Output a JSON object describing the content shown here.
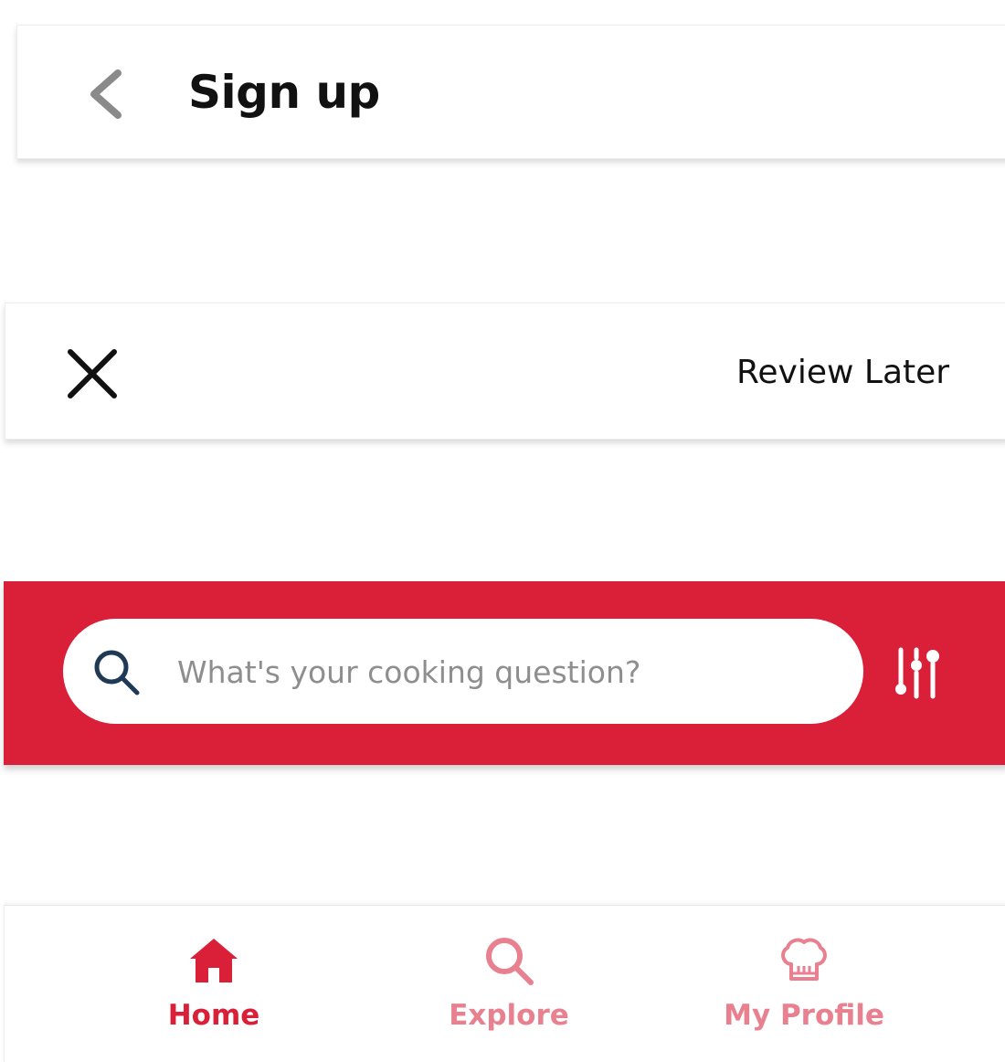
{
  "signup_header": {
    "title": "Sign up",
    "back_icon": "chevron-left-icon"
  },
  "review_header": {
    "close_icon": "close-icon",
    "action_label": "Review Later"
  },
  "search": {
    "placeholder": "What's your cooking question?",
    "value": "",
    "search_icon": "search-icon",
    "filter_icon": "sliders-icon"
  },
  "bottom_nav": {
    "items": [
      {
        "label": "Home",
        "icon": "home-icon",
        "active": true
      },
      {
        "label": "Explore",
        "icon": "search-icon",
        "active": false
      },
      {
        "label": "My Profile",
        "icon": "chef-hat-icon",
        "active": false
      }
    ]
  },
  "colors": {
    "brand_red": "#d92038",
    "inactive_nav": "#e8808f",
    "text_dark": "#111111",
    "placeholder_gray": "#8e8e8e",
    "back_chevron_gray": "#8a8a8a",
    "search_icon_navy": "#203a55"
  }
}
